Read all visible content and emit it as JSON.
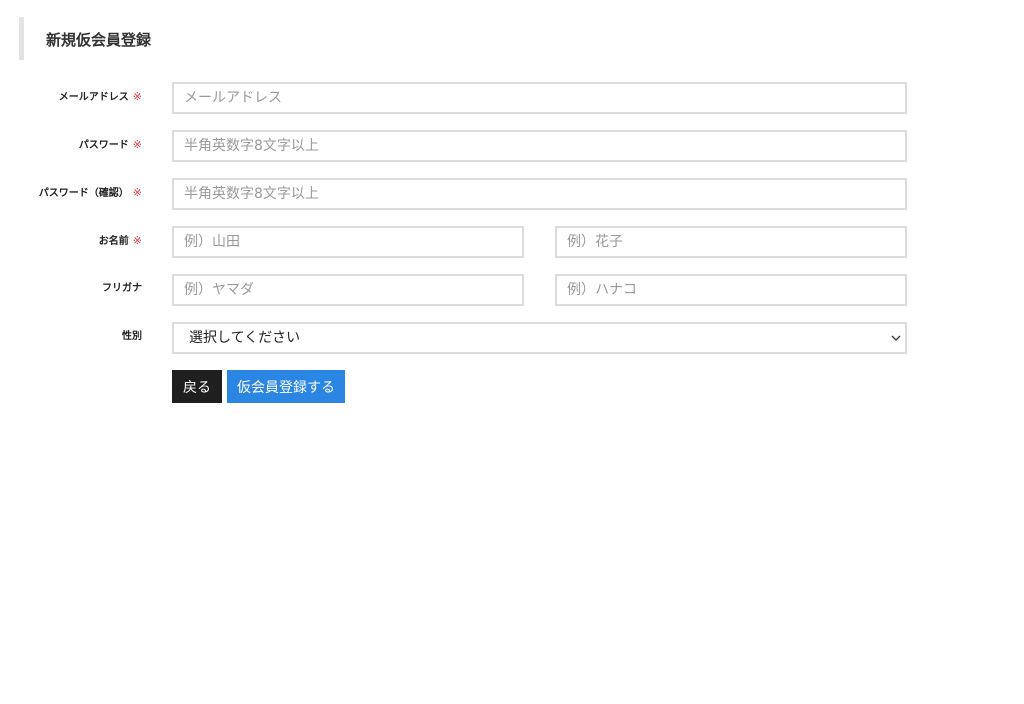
{
  "header": {
    "title": "新規仮会員登録"
  },
  "required_mark": "※",
  "fields": {
    "email": {
      "label": "メールアドレス",
      "placeholder": "メールアドレス",
      "value": ""
    },
    "password": {
      "label": "パスワード",
      "placeholder": "半角英数字8文字以上",
      "value": ""
    },
    "password_confirm": {
      "label": "パスワード（確認）",
      "placeholder": "半角英数字8文字以上",
      "value": ""
    },
    "name": {
      "label": "お名前",
      "last_placeholder": "例）山田",
      "first_placeholder": "例）花子"
    },
    "furigana": {
      "label": "フリガナ",
      "last_placeholder": "例）ヤマダ",
      "first_placeholder": "例）ハナコ"
    },
    "gender": {
      "label": "性別",
      "selected": "選択してください"
    }
  },
  "actions": {
    "back_label": "戻る",
    "submit_label": "仮会員登録する"
  },
  "colors": {
    "required": "#e0343c",
    "submit_button": "#2a86e2",
    "back_button": "#1f1f1f",
    "input_border": "#dcdcdc"
  }
}
